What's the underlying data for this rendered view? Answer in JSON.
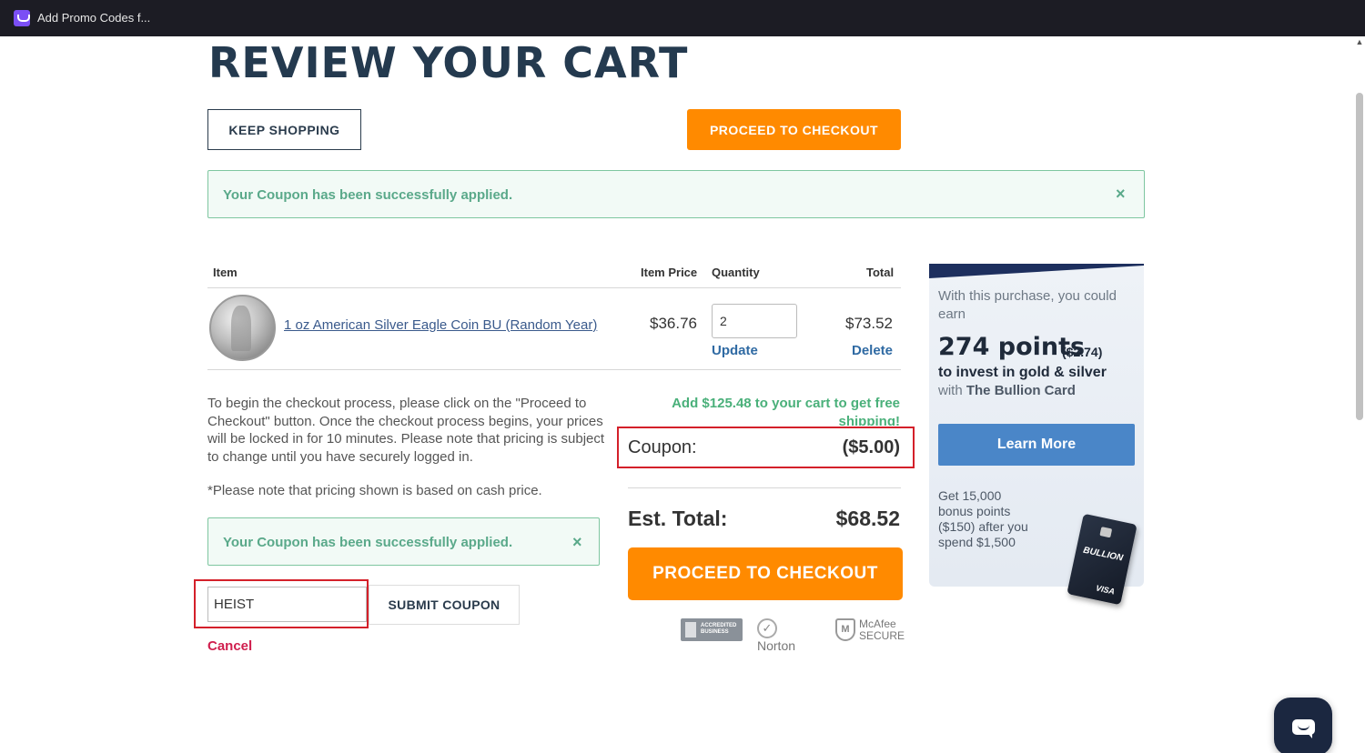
{
  "browser": {
    "tab_title": "Add Promo Codes f..."
  },
  "page": {
    "title": "REVIEW YOUR CART"
  },
  "buttons": {
    "keep_shopping": "KEEP SHOPPING",
    "proceed_top": "PROCEED TO CHECKOUT",
    "proceed_main": "PROCEED TO CHECKOUT",
    "submit_coupon": "SUBMIT COUPON",
    "cancel": "Cancel",
    "learn_more": "Learn More"
  },
  "alerts": {
    "top_message": "Your Coupon has been successfully applied.",
    "bottom_message": "Your Coupon has been successfully applied.",
    "close_glyph": "×"
  },
  "cart_table": {
    "headers": {
      "item": "Item",
      "item_price": "Item Price",
      "quantity": "Quantity",
      "total": "Total"
    },
    "rows": [
      {
        "name": "1 oz American Silver Eagle Coin BU (Random Year)",
        "price": "$36.76",
        "quantity": "2",
        "update_label": "Update",
        "delete_label": "Delete",
        "total": "$73.52"
      }
    ]
  },
  "checkout_info": {
    "paragraph": "To begin the checkout process, please click on the \"Proceed to Checkout\" button. Once the checkout process begins, your prices will be locked in for 10 minutes. Please note that pricing is subject to change until you have securely logged in.",
    "note": "*Please note that pricing shown is based on cash price."
  },
  "coupon_form": {
    "value": "HEIST"
  },
  "summary": {
    "free_shipping": "Add $125.48 to your cart to get free shipping!",
    "coupon_label": "Coupon:",
    "coupon_value": "($5.00)",
    "est_total_label": "Est. Total:",
    "est_total_value": "$68.52"
  },
  "trust_badges": {
    "bbb": "ACCREDITED BUSINESS",
    "norton": "Norton",
    "mcafee": "McAfee SECURE"
  },
  "promo": {
    "earn_text": "With this purchase, you could earn",
    "points": "274 points",
    "points_usd": "($2.74)",
    "invest_text": "to invest in gold & silver",
    "with_text": "with",
    "card_brand": "The Bullion Card",
    "bonus_text": "Get 15,000 bonus points ($150) after you spend $1,500",
    "card_label": "BULLION",
    "card_network": "VISA"
  },
  "colors": {
    "accent_orange": "#ff8a00",
    "title_navy": "#243a4f",
    "success_green": "#5aa98a",
    "highlight_red": "#d4202a",
    "link_blue": "#2f6aa3",
    "cancel_red": "#d01f4e"
  }
}
